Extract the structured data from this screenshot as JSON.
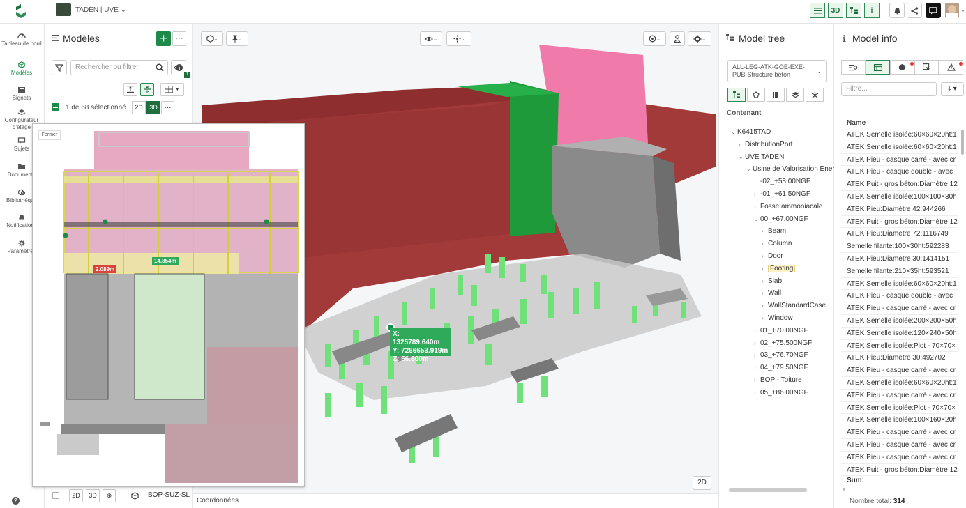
{
  "app": {
    "project_name": "TADEN | UVE",
    "colors": {
      "brand": "#1e8a4a",
      "accent_dark": "#1e6e3e",
      "wall": "#a33a3a",
      "footing": "#7fe08a"
    }
  },
  "topbar": {
    "right_tools": [
      {
        "icon": "list-icon",
        "label": ""
      },
      {
        "icon": "3d-icon",
        "label": "3D"
      },
      {
        "icon": "tree-icon",
        "label": ""
      },
      {
        "icon": "info-icon",
        "label": "i"
      }
    ]
  },
  "nav": {
    "items": [
      {
        "label": "Tableau de bord",
        "icon": "dashboard-icon"
      },
      {
        "label": "Modèles",
        "icon": "cube-icon"
      },
      {
        "label": "Signets",
        "icon": "bookmark-icon"
      },
      {
        "label": "Configurateur d'étage",
        "icon": "layers-icon"
      },
      {
        "label": "Sujets",
        "icon": "issue-icon"
      },
      {
        "label": "Documents",
        "icon": "folder-icon"
      },
      {
        "label": "Bibliothèque",
        "icon": "library-icon"
      },
      {
        "label": "Notifications",
        "icon": "bell-icon"
      },
      {
        "label": "Paramètres",
        "icon": "gear-icon"
      }
    ],
    "help": "?"
  },
  "models": {
    "title": "Modèles",
    "add": "+",
    "more": "···",
    "search_placeholder": "Rechercher ou filtrer",
    "info_badge": "1",
    "selection": "1 de 68 sélectionné",
    "toggle_2d": "2D",
    "toggle_3d": "3D",
    "more2": "···",
    "bottom_row": {
      "toggle_2d": "2D",
      "toggle_3d": "3D",
      "name": "BOP-SUZ-SL"
    }
  },
  "viewer": {
    "close_label": "Fermer",
    "dim_red": "2.089m",
    "dim_green": "14.854m",
    "coords": {
      "x": "X: 1325789.640m",
      "y": "Y: 7266653.919m",
      "z": "Z: 66.600m"
    },
    "btn_2d": "2D",
    "coord_label": "Coordonnées"
  },
  "tree": {
    "title": "Model tree",
    "selector": "ALL-LEG-ATK-GOE-EXE-PUB-Structure béton",
    "contenant": "Contenant",
    "rows": [
      {
        "label": "K6415TAD",
        "chev": "⌄",
        "depth": 0
      },
      {
        "label": "DistributionPort",
        "chev": "›",
        "depth": 1
      },
      {
        "label": "UVE TADEN",
        "chev": "⌄",
        "depth": 1
      },
      {
        "label": "Usine de Valorisation Energétique",
        "chev": "⌄",
        "depth": 2
      },
      {
        "label": "-02_+58.00NGF",
        "chev": "",
        "depth": 3
      },
      {
        "label": "-01_+61.50NGF",
        "chev": "›",
        "depth": 3
      },
      {
        "label": "Fosse ammoniacale",
        "chev": "›",
        "depth": 3
      },
      {
        "label": "00_+67.00NGF",
        "chev": "⌄",
        "depth": 3
      },
      {
        "label": "Beam",
        "chev": "›",
        "depth": 4
      },
      {
        "label": "Column",
        "chev": "›",
        "depth": 4
      },
      {
        "label": "Door",
        "chev": "›",
        "depth": 4
      },
      {
        "label": "Footing",
        "chev": "›",
        "depth": 4,
        "highlight": true
      },
      {
        "label": "Slab",
        "chev": "›",
        "depth": 4
      },
      {
        "label": "Wall",
        "chev": "›",
        "depth": 4
      },
      {
        "label": "WallStandardCase",
        "chev": "›",
        "depth": 4
      },
      {
        "label": "Window",
        "chev": "›",
        "depth": 4
      },
      {
        "label": "01_+70.00NGF",
        "chev": "›",
        "depth": 3
      },
      {
        "label": "02_+75.500NGF",
        "chev": "›",
        "depth": 3
      },
      {
        "label": "03_+76.70NGF",
        "chev": "›",
        "depth": 3
      },
      {
        "label": "04_+79.50NGF",
        "chev": "›",
        "depth": 3
      },
      {
        "label": "BOP - Toiture",
        "chev": "›",
        "depth": 3
      },
      {
        "label": "05_+86.00NGF",
        "chev": "›",
        "depth": 3
      }
    ]
  },
  "info": {
    "title": "Model info",
    "filter_placeholder": "Filtre...",
    "download": "⤓ ▾",
    "column": "Name",
    "rows": [
      "ATEK Semelle isolée:60×60×20ht:1",
      "ATEK Semelle isolée:60×60×20ht:1",
      "ATEK Pieu - casque carré - avec cr",
      "ATEK Pieu - casque double - avec",
      "ATEK Puit - gros béton:Diamètre 12",
      "ATEK Semelle isolée:100×100×30h",
      "ATEK Pieu:Diamètre 42:944266",
      "ATEK Puit - gros béton:Diamètre 12",
      "ATEK Pieu:Diamètre 72:1116749",
      "Semelle filante:100×30ht:592283",
      "ATEK Pieu:Diamètre 30:1414151",
      "Semelle filante:210×35ht:593521",
      "ATEK Semelle isolée:60×60×20ht:1",
      "ATEK Pieu - casque double - avec",
      "ATEK Pieu - casque carré - avec cr",
      "ATEK Semelle isolée:200×200×50h",
      "ATEK Semelle isolée:120×240×50h",
      "ATEK Semelle isolée:Plot - 70×70×",
      "ATEK Pieu:Diamètre 30:492702",
      "ATEK Pieu - casque carré - avec cr",
      "ATEK Semelle isolée:60×60×20ht:1",
      "ATEK Pieu - casque carré - avec cr",
      "ATEK Semelle isolée:Plot - 70×70×",
      "ATEK Semelle isolée:100×160×20h",
      "ATEK Pieu - casque carré - avec cr",
      "ATEK Pieu - casque carré - avec cr",
      "ATEK Pieu - casque carré - avec cr",
      "ATEK Puit - gros béton:Diamètre 12"
    ],
    "sum": "Sum:",
    "total_prefix": "Nombre total:",
    "total_value": "314"
  }
}
